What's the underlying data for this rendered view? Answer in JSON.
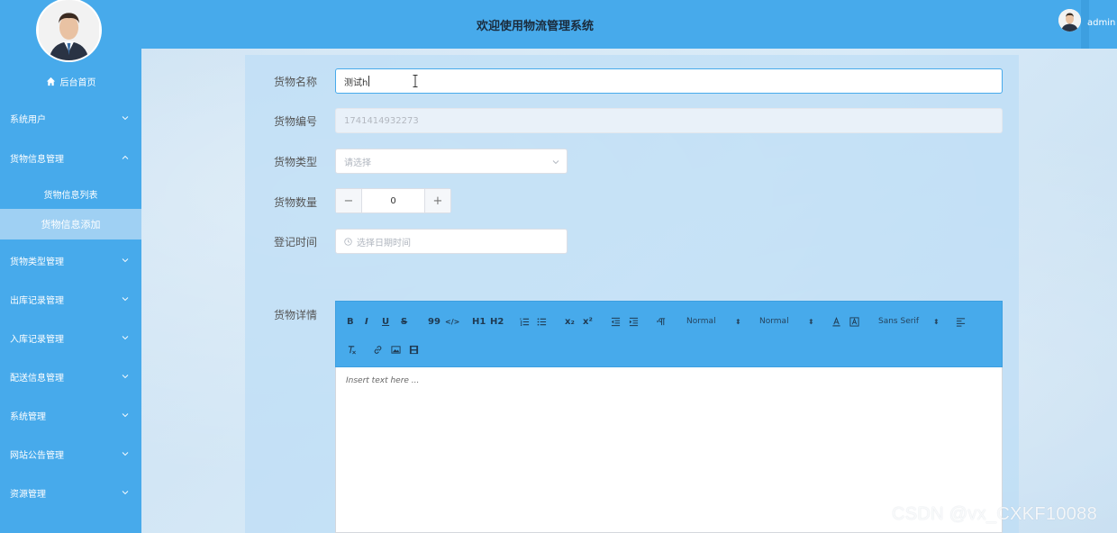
{
  "header": {
    "title": "欢迎使用物流管理系统",
    "username": "admin"
  },
  "sidebar": {
    "home_label": "后台首页",
    "menus": [
      {
        "label": "系统用户",
        "expanded": false
      },
      {
        "label": "货物信息管理",
        "expanded": true
      },
      {
        "label": "货物类型管理",
        "expanded": false
      },
      {
        "label": "出库记录管理",
        "expanded": false
      },
      {
        "label": "入库记录管理",
        "expanded": false
      },
      {
        "label": "配送信息管理",
        "expanded": false
      },
      {
        "label": "系统管理",
        "expanded": false
      },
      {
        "label": "网站公告管理",
        "expanded": false
      },
      {
        "label": "资源管理",
        "expanded": false
      }
    ],
    "submenu": [
      {
        "label": "货物信息列表",
        "active": false
      },
      {
        "label": "货物信息添加",
        "active": true
      }
    ]
  },
  "form": {
    "name": {
      "label": "货物名称",
      "value": "测试h"
    },
    "code": {
      "label": "货物编号",
      "value": "1741414932273"
    },
    "type": {
      "label": "货物类型",
      "placeholder": "请选择"
    },
    "quantity": {
      "label": "货物数量",
      "value": "0",
      "minus": "−",
      "plus": "+"
    },
    "time": {
      "label": "登记时间",
      "placeholder": "选择日期时间"
    },
    "detail": {
      "label": "货物详情"
    }
  },
  "editor": {
    "toolbar": {
      "bold": "B",
      "italic": "I",
      "underline": "U",
      "strike": "S",
      "blockquote": "99",
      "code": "</>",
      "h1": "H1",
      "h2": "H2",
      "sub": "x₂",
      "sup": "x²",
      "size": "Normal",
      "header": "Normal",
      "font": "Sans Serif"
    },
    "placeholder": "Insert text here ..."
  },
  "watermark": "CSDN @vx_CXKF10088",
  "colors": {
    "sidebar": "#47aaeb",
    "active_submenu": "#9fd0f3",
    "focus_border": "#47aaeb"
  }
}
